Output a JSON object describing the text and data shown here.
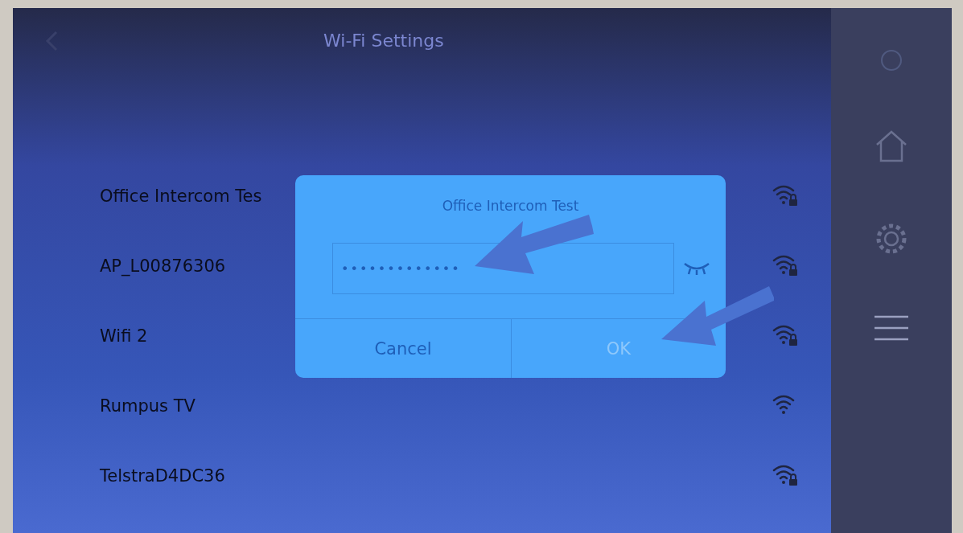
{
  "header": {
    "title": "Wi-Fi Settings"
  },
  "networks": [
    {
      "name": "Office Intercom Tes",
      "locked": true
    },
    {
      "name": "AP_L00876306",
      "locked": true
    },
    {
      "name": "Wifi 2",
      "locked": true
    },
    {
      "name": "Rumpus TV",
      "locked": false
    },
    {
      "name": "TelstraD4DC36",
      "locked": true
    }
  ],
  "dialog": {
    "title": "Office Intercom Test",
    "password": "•••••••••••••",
    "password_visible": false,
    "buttons": [
      {
        "label": "Cancel",
        "disabled": false
      },
      {
        "label": "OK",
        "disabled": true
      }
    ]
  }
}
